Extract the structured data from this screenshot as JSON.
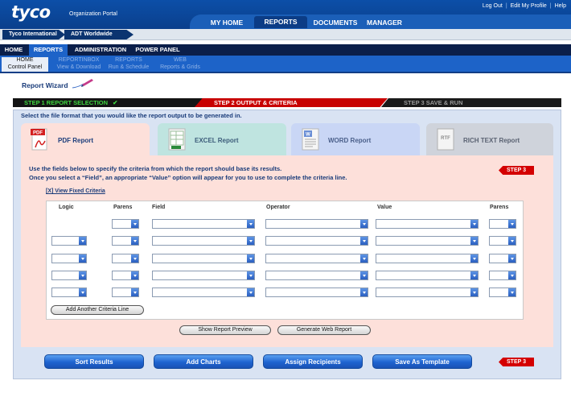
{
  "header": {
    "logo": "tyco",
    "portal_label": "Organization Portal",
    "top_links": [
      "Log Out",
      "Edit My Profile",
      "Help"
    ],
    "main_tabs": [
      {
        "label": "MY HOME",
        "active": false
      },
      {
        "label": "REPORTS",
        "active": true
      },
      {
        "label": "DOCUMENTS",
        "active": false
      },
      {
        "label": "MANAGER",
        "active": false
      }
    ]
  },
  "breadcrumb": [
    "Tyco International",
    "ADT Worldwide"
  ],
  "nav2": [
    {
      "label": "HOME",
      "active": false
    },
    {
      "label": "REPORTS",
      "active": true
    },
    {
      "label": "ADMINISTRATION",
      "active": false
    },
    {
      "label": "POWER PANEL",
      "active": false
    }
  ],
  "nav3": [
    {
      "line1": "HOME",
      "line2": "Control Panel",
      "active": true
    },
    {
      "line1": "REPORTINBOX",
      "line2": "View & Download",
      "active": false
    },
    {
      "line1": "REPORTS",
      "line2": "Run & Schedule",
      "active": false
    },
    {
      "line1": "WEB",
      "line2": "Reports & Grids",
      "active": false
    }
  ],
  "wizard": {
    "title": "Report Wizard",
    "steps": [
      {
        "label": "STEP 1 REPORT SELECTION",
        "state": "done"
      },
      {
        "label": "STEP 2 OUTPUT & CRITERIA",
        "state": "current"
      },
      {
        "label": "STEP 3 SAVE & RUN",
        "state": "pending"
      }
    ],
    "format_instruction": "Select the file format that you would like the report output to be generated in.",
    "formats": [
      {
        "label": "PDF Report",
        "icon_text": "PDF",
        "active": true
      },
      {
        "label": "EXCEL Report",
        "icon_text": "",
        "active": false
      },
      {
        "label": "WORD Report",
        "icon_text": "W",
        "active": false
      },
      {
        "label": "RICH TEXT Report",
        "icon_text": "RTF",
        "active": false
      }
    ],
    "criteria_line1": "Use the fields below to specify the criteria from which the report should base its results.",
    "criteria_line2": "Once you select a “Field”, an appropriate “Value” option will appear for you to use to complete the criteria line.",
    "step3_badge": "STEP 3",
    "view_fixed": "[X] View Fixed Criteria",
    "columns": [
      "Logic",
      "Parens",
      "Field",
      "Operator",
      "Value",
      "Parens"
    ],
    "row_count": 5,
    "add_line_button": "Add Another Criteria Line",
    "preview_button": "Show Report Preview",
    "generate_button": "Generate Web Report",
    "bottom_buttons": [
      "Sort Results",
      "Add Charts",
      "Assign Recipients",
      "Save As Template"
    ]
  },
  "colors": {
    "brand_blue": "#0c4fa8",
    "step_done_green": "#1f8a1f",
    "step_current_red": "#c80000",
    "step_badge_red": "#d40000",
    "content_pink": "#fde0da",
    "panel_blue": "#d9e3f3"
  }
}
